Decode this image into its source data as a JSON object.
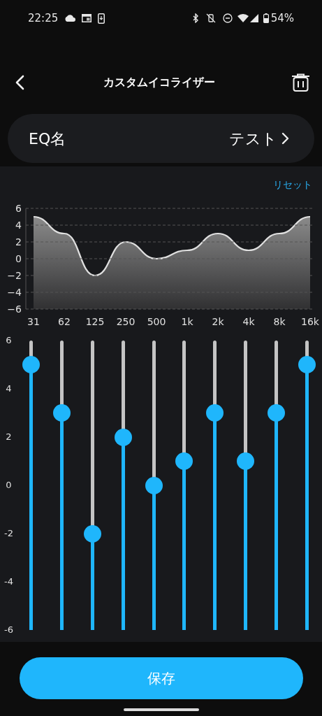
{
  "status_bar": {
    "time": "22:25",
    "battery": "54%"
  },
  "header": {
    "title": "カスタムイコライザー"
  },
  "eq_name": {
    "label": "EQ名",
    "value": "テスト"
  },
  "reset": "リセット",
  "chart": {
    "chart_data": {
      "type": "area",
      "grid": true,
      "categories": [
        "31",
        "62",
        "125",
        "250",
        "500",
        "1k",
        "2k",
        "4k",
        "8k",
        "16k"
      ],
      "yticks": [
        {
          "value": 6,
          "label": "6"
        },
        {
          "value": 4,
          "label": "4"
        },
        {
          "value": 2,
          "label": "2"
        },
        {
          "value": 0,
          "label": "0"
        },
        {
          "value": -2,
          "label": "−2"
        },
        {
          "value": -4,
          "label": "−4"
        },
        {
          "value": -6,
          "label": "−6"
        }
      ],
      "ylim": [
        -6,
        6
      ],
      "series": [
        {
          "color": "#e0e0e0",
          "values": [
            5,
            3,
            -2,
            2,
            0,
            1,
            3,
            1,
            3,
            5
          ]
        }
      ]
    }
  },
  "slider_scale": [
    "6",
    "4",
    "2",
    "0",
    "-2",
    "-4",
    "-6"
  ],
  "sliders": [
    {
      "level": 0.9167
    },
    {
      "level": 0.75
    },
    {
      "level": 0.3333
    },
    {
      "level": 0.6667
    },
    {
      "level": 0.5
    },
    {
      "level": 0.5833
    },
    {
      "level": 0.75
    },
    {
      "level": 0.5833
    },
    {
      "level": 0.75
    },
    {
      "level": 0.9167
    }
  ],
  "save_button": "保存"
}
